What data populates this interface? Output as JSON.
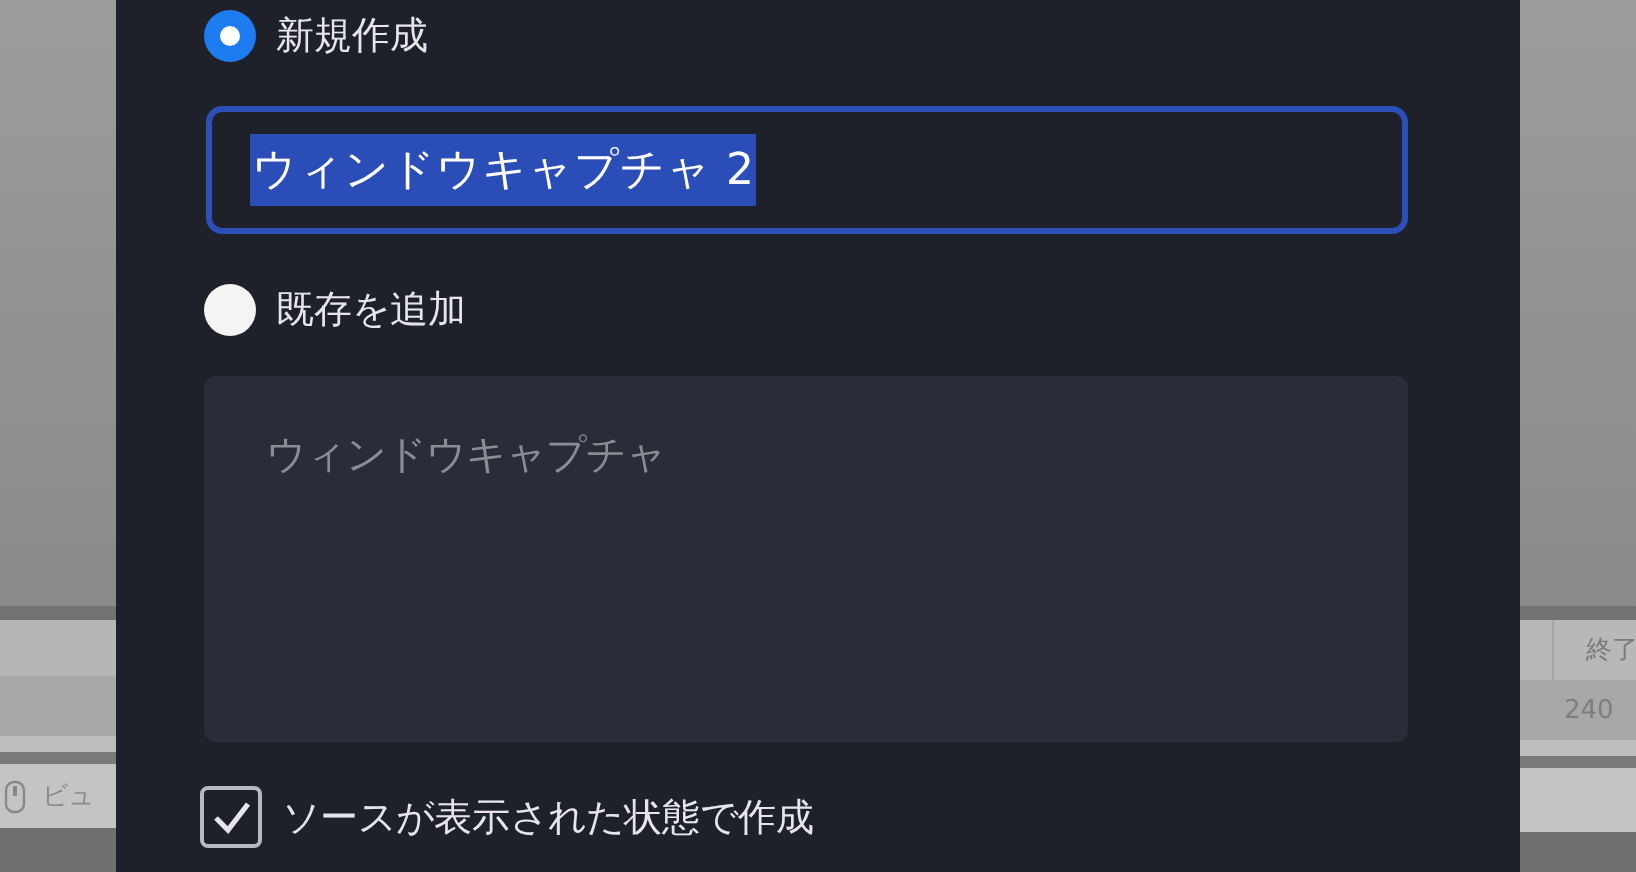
{
  "background": {
    "left_label": "ビュ",
    "right_header": "終了",
    "right_value": "240"
  },
  "dialog": {
    "options": [
      {
        "kind": "radio",
        "label": "新規作成",
        "selected": true
      },
      {
        "kind": "field",
        "value": "ウィンドウキャプチャ 2",
        "text_selected": true,
        "focused": true
      },
      {
        "kind": "radio",
        "label": "既存を追加",
        "selected": false
      },
      {
        "kind": "list",
        "items": [
          "ウィンドウキャプチャ"
        ],
        "disabled": true
      },
      {
        "kind": "checkbox",
        "label": "ソースが表示された状態で作成",
        "checked": true
      }
    ]
  }
}
